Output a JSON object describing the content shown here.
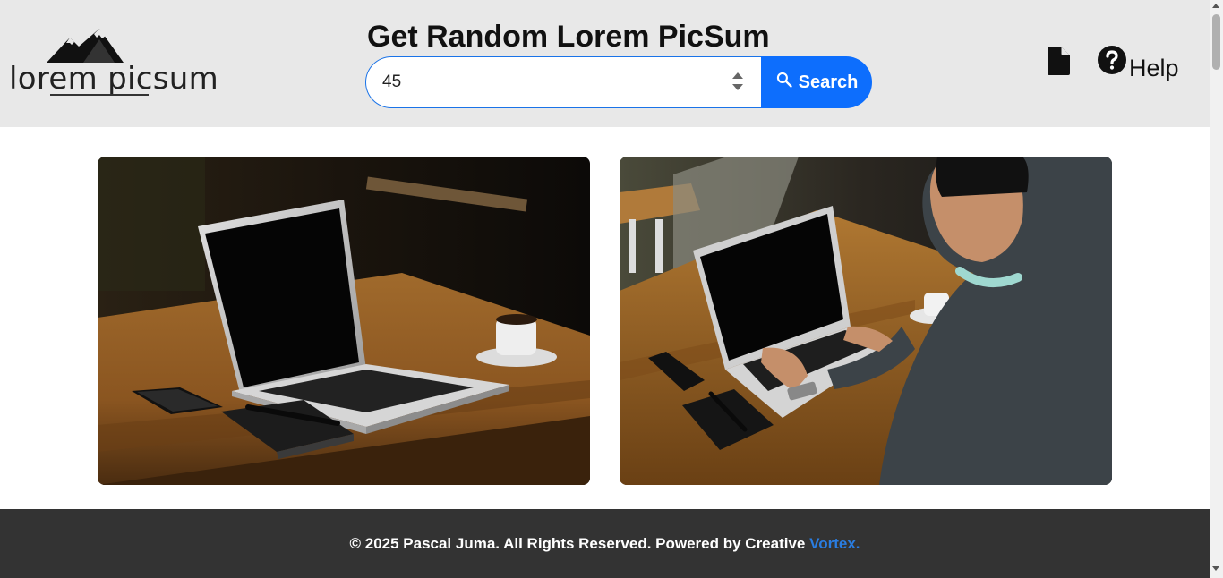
{
  "header": {
    "logo_text": "lorem picsum",
    "title": "Get Random Lorem PicSum",
    "search": {
      "value": "45",
      "button_label": "Search"
    },
    "help_label": "Help"
  },
  "gallery": {
    "images": [
      {
        "description": "laptop-on-wooden-table"
      },
      {
        "description": "person-typing-on-laptop"
      }
    ]
  },
  "footer": {
    "text": "© 2025 Pascal Juma. All Rights Reserved. Powered by Creative ",
    "link_text": "Vortex."
  },
  "colors": {
    "header_bg": "#e8e8e8",
    "accent": "#0d6efd",
    "footer_bg": "#333333",
    "footer_link": "#2a7de1"
  },
  "icons": [
    "mountain-logo-icon",
    "search-icon",
    "document-icon",
    "help-circle-icon"
  ]
}
